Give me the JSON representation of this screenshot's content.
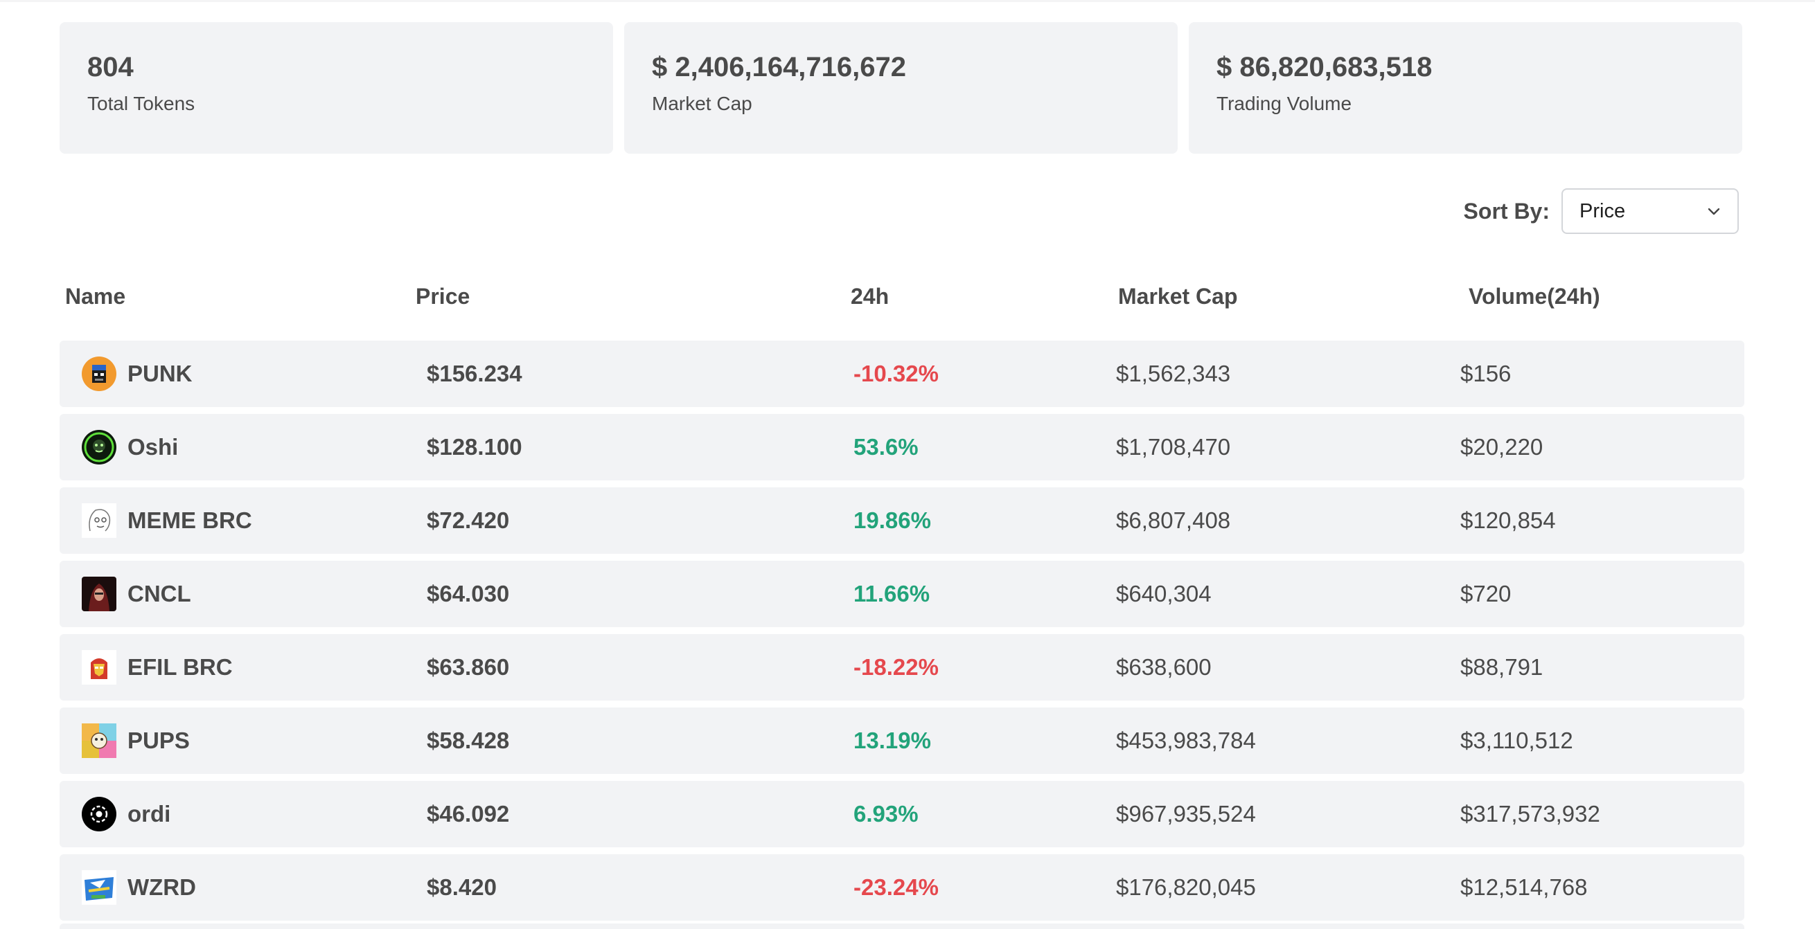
{
  "stats": [
    {
      "value": "804",
      "label": "Total Tokens"
    },
    {
      "value": "$ 2,406,164,716,672",
      "label": "Market Cap"
    },
    {
      "value": "$ 86,820,683,518",
      "label": "Trading Volume"
    }
  ],
  "sort": {
    "label": "Sort By:",
    "selected": "Price",
    "icon": "chevron-down-icon"
  },
  "table": {
    "headers": {
      "name": "Name",
      "price": "Price",
      "change": "24h",
      "market_cap": "Market Cap",
      "volume": "Volume(24h)"
    },
    "rows": [
      {
        "icon": "punk-token-icon",
        "name": "PUNK",
        "price": "$156.234",
        "change": "-10.32%",
        "trend": "down",
        "market_cap": "$1,562,343",
        "volume": "$156"
      },
      {
        "icon": "oshi-token-icon",
        "name": "Oshi",
        "price": "$128.100",
        "change": "53.6%",
        "trend": "up",
        "market_cap": "$1,708,470",
        "volume": "$20,220"
      },
      {
        "icon": "meme-brc-token-icon",
        "name": "MEME BRC",
        "price": "$72.420",
        "change": "19.86%",
        "trend": "up",
        "market_cap": "$6,807,408",
        "volume": "$120,854"
      },
      {
        "icon": "cncl-token-icon",
        "name": "CNCL",
        "price": "$64.030",
        "change": "11.66%",
        "trend": "up",
        "market_cap": "$640,304",
        "volume": "$720"
      },
      {
        "icon": "efil-brc-token-icon",
        "name": "EFIL BRC",
        "price": "$63.860",
        "change": "-18.22%",
        "trend": "down",
        "market_cap": "$638,600",
        "volume": "$88,791"
      },
      {
        "icon": "pups-token-icon",
        "name": "PUPS",
        "price": "$58.428",
        "change": "13.19%",
        "trend": "up",
        "market_cap": "$453,983,784",
        "volume": "$3,110,512"
      },
      {
        "icon": "ordi-token-icon",
        "name": "ordi",
        "price": "$46.092",
        "change": "6.93%",
        "trend": "up",
        "market_cap": "$967,935,524",
        "volume": "$317,573,932"
      },
      {
        "icon": "wzrd-token-icon",
        "name": "WZRD",
        "price": "$8.420",
        "change": "-23.24%",
        "trend": "down",
        "market_cap": "$176,820,045",
        "volume": "$12,514,768"
      }
    ]
  },
  "colors": {
    "negative": "#e5484d",
    "positive": "#22a37a",
    "card_bg": "#f2f3f5"
  }
}
